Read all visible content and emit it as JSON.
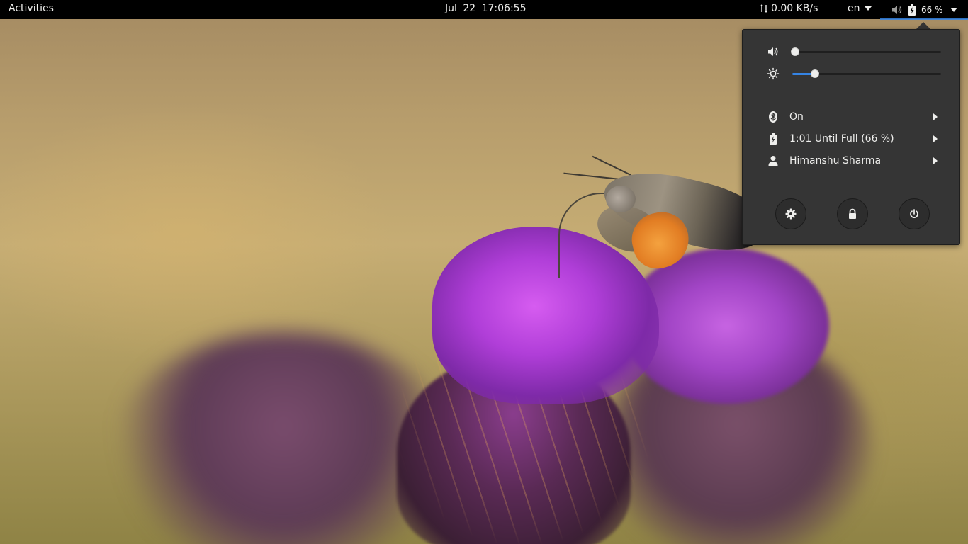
{
  "topbar": {
    "activities_label": "Activities",
    "clock": "Jul 22  17:06:55",
    "net_speed": "0.00 KB/s",
    "net_icon": "up-down-arrows-icon",
    "keyboard_layout": "en",
    "volume_icon": "speaker-icon",
    "battery_icon": "battery-charging-icon",
    "battery_percent": "66 %"
  },
  "system_menu": {
    "volume": {
      "icon": "speaker-icon",
      "level": 0.02
    },
    "brightness": {
      "icon": "brightness-icon",
      "level": 0.15
    },
    "items": [
      {
        "icon": "bluetooth-icon",
        "label": "On"
      },
      {
        "icon": "battery-charging-icon",
        "label": "1:01 Until Full (66 %)"
      },
      {
        "icon": "user-icon",
        "label": "Himanshu Sharma"
      }
    ],
    "buttons": [
      {
        "icon": "gear-icon",
        "name": "settings"
      },
      {
        "icon": "lock-icon",
        "name": "lock"
      },
      {
        "icon": "power-icon",
        "name": "power-off"
      }
    ]
  },
  "colors": {
    "panel_bg": "#000000",
    "menu_bg": "#353535",
    "accent": "#3584e4",
    "text": "#eeeeec"
  }
}
